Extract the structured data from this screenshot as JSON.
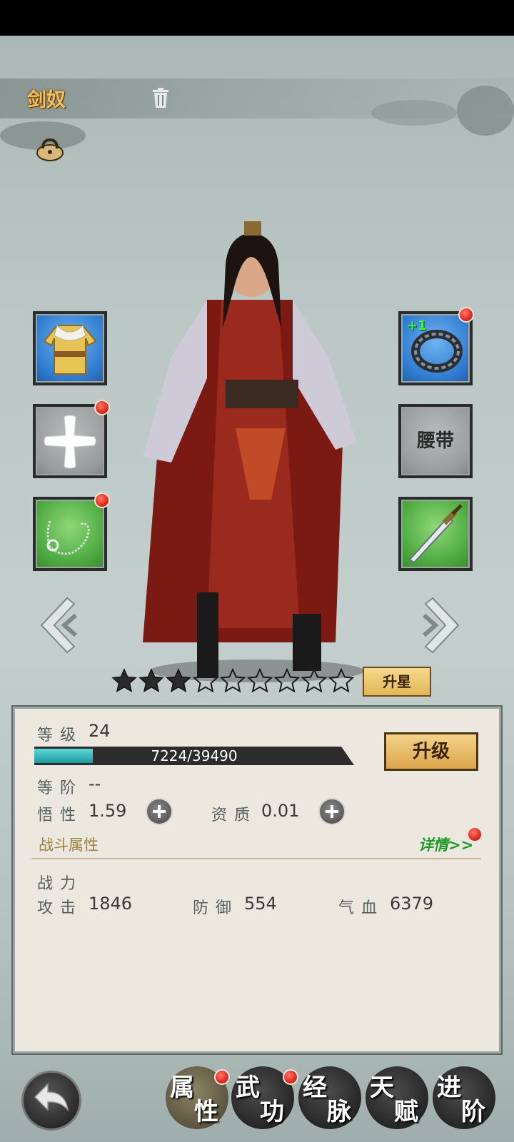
{
  "hero": {
    "name": "剑奴"
  },
  "equipment": {
    "left": [
      {
        "id": "armor",
        "label": "",
        "rarity": "blue",
        "badge": false,
        "icon": "robe-icon"
      },
      {
        "id": "slot-add",
        "label": "",
        "rarity": "gray",
        "badge": true,
        "icon": "plus-icon"
      },
      {
        "id": "necklace",
        "label": "",
        "rarity": "green",
        "badge": true,
        "icon": "necklace-icon"
      }
    ],
    "right": [
      {
        "id": "ring",
        "label": "+1",
        "rarity": "blue",
        "badge": true,
        "icon": "ring-icon"
      },
      {
        "id": "belt",
        "label": "腰带",
        "rarity": "gray",
        "badge": false,
        "icon": ""
      },
      {
        "id": "sword",
        "label": "",
        "rarity": "green",
        "badge": false,
        "icon": "sword-icon"
      }
    ]
  },
  "stars": {
    "filled": 3,
    "total": 9,
    "button_label": "升星"
  },
  "stats": {
    "level_label": "等级",
    "level_value": "24",
    "exp_text": "7224/39490",
    "exp_fraction": 0.183,
    "upgrade_label": "升级",
    "rank_label": "等阶",
    "rank_value": "--",
    "insight_label": "悟性",
    "insight_value": "1.59",
    "aptitude_label": "资质",
    "aptitude_value": "0.01"
  },
  "combat": {
    "section_title": "战斗属性",
    "details_link": "详情>>",
    "power_label": "战力",
    "attack_label": "攻击",
    "attack_value": "1846",
    "defense_label": "防御",
    "defense_value": "554",
    "hp_label": "气血",
    "hp_value": "6379"
  },
  "tabs": [
    {
      "c1": "属",
      "c2": "性",
      "active": true,
      "badge": true
    },
    {
      "c1": "武",
      "c2": "功",
      "active": false,
      "badge": true
    },
    {
      "c1": "经",
      "c2": "脉",
      "active": false,
      "badge": false
    },
    {
      "c1": "天",
      "c2": "赋",
      "active": false,
      "badge": false
    },
    {
      "c1": "进",
      "c2": "阶",
      "active": false,
      "badge": false
    }
  ],
  "colors": {
    "gold": "#f4c25a",
    "exp": "#1d9aa2",
    "badge": "#e0291f"
  }
}
